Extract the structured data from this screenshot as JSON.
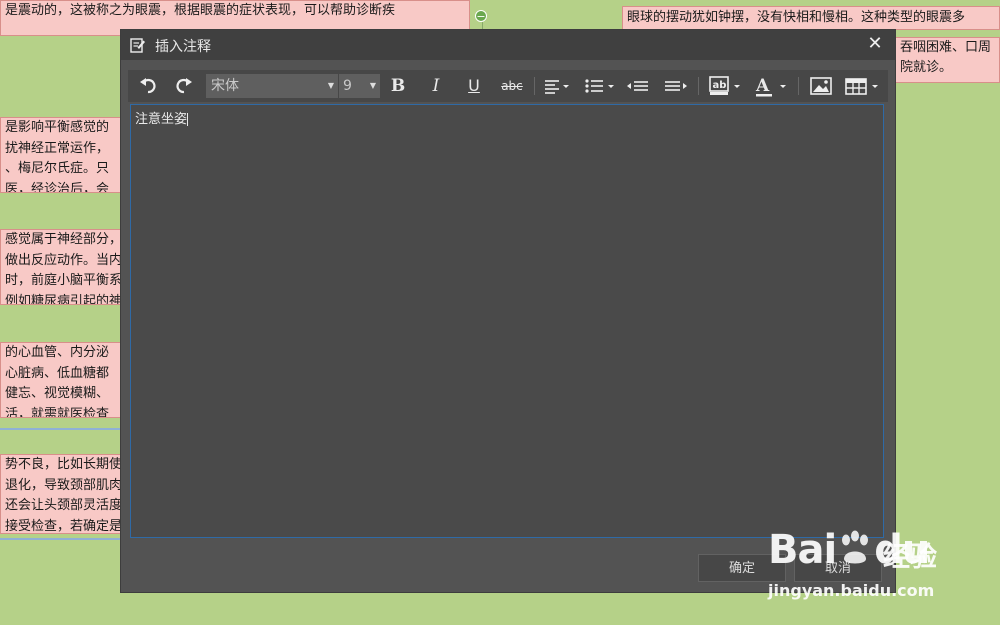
{
  "background": {
    "top_left_node": "是震动的，这被称之为眼震，根据眼震的症状表现，可以帮助诊断疾",
    "top_right_node": "眼球的摆动犹如钟摆，没有快相和慢相。这种类型的眼震多",
    "right_node_lines": [
      "吞咽困难、口周",
      "院就诊。"
    ],
    "left_nodes": [
      [
        "是影响平衡感觉的",
        "扰神经正常运作，",
        "、梅尼尔氏症。只",
        "医，经诊治后，会"
      ],
      [
        "感觉属于神经部分，",
        "做出反应动作。当内",
        "时，前庭小脑平衡系",
        "例如糖尿病引起的神"
      ],
      [
        "的心血管、内分泌",
        "心脏病、低血糖都",
        "健忘、视觉模糊、",
        "活，就需就医检查"
      ],
      [
        "势不良，比如长期使",
        "退化，导致颈部肌肉",
        "还会让头颈部灵活度",
        "接受检查，若确定是"
      ]
    ],
    "collapse_symbol": "−"
  },
  "dialog": {
    "title": "插入注释",
    "close_symbol": "✕",
    "toolbar": {
      "font_name": "宋体",
      "font_size": "9",
      "bold": "B",
      "italic": "I",
      "underline": "U",
      "strikethrough": "abc",
      "font_color_label": "A"
    },
    "editor_text": "注意坐姿",
    "ok_label": "确定",
    "cancel_label": "取消"
  },
  "watermark": {
    "logo": "Bai",
    "logo_suffix": "du",
    "cn": "经验",
    "url": "jingyan.baidu.com"
  },
  "colors": {
    "background": "#b5d188",
    "node_fill": "#f8c9c6",
    "dialog": "#535353",
    "editor_border": "#2f6aa6"
  }
}
